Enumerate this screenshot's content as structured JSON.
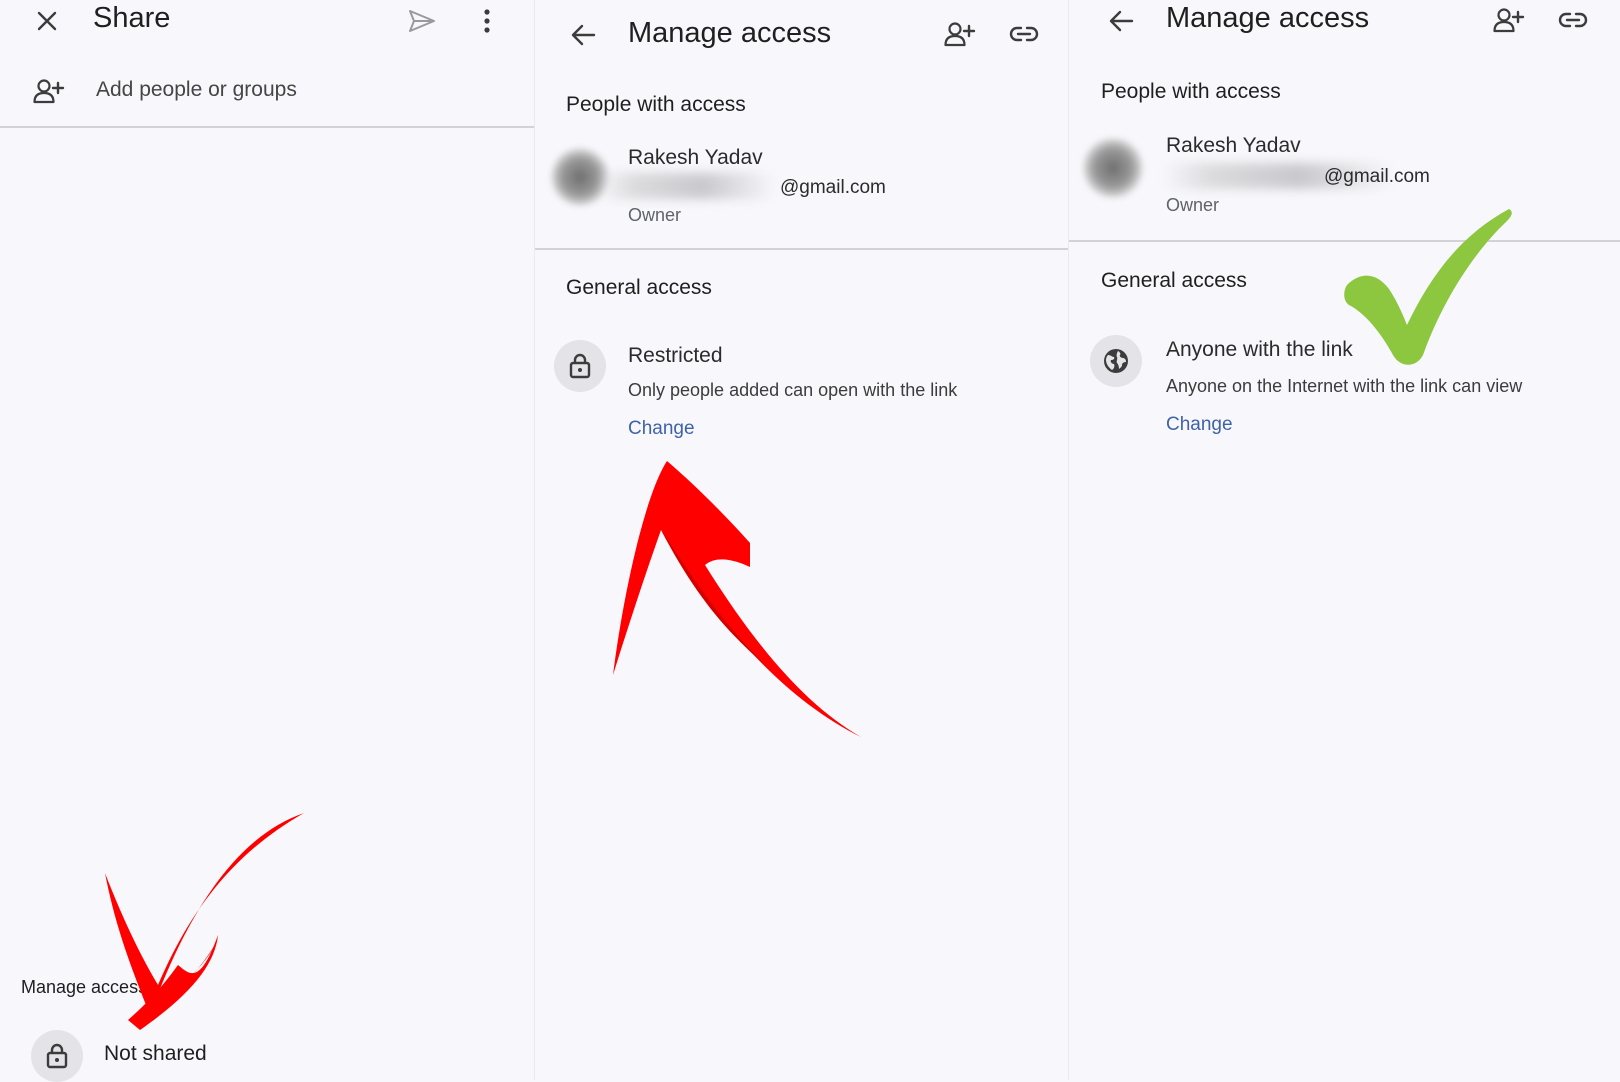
{
  "share_panel": {
    "title": "Share",
    "add_people_label": "Add people or groups",
    "manage_access_label": "Manage access",
    "status_label": "Not shared",
    "icons": {
      "close": "close-icon",
      "send": "send-icon",
      "more": "more-vert-icon",
      "add_person": "person-add-icon",
      "lock": "lock-icon"
    }
  },
  "manage_panel_restricted": {
    "title": "Manage access",
    "people_section": "People with access",
    "person": {
      "name": "Rakesh Yadav",
      "email_visible": "@gmail.com",
      "role": "Owner"
    },
    "general_section": "General access",
    "access": {
      "title": "Restricted",
      "description": "Only people added can open with the link",
      "change_label": "Change"
    },
    "icons": {
      "back": "back-arrow-icon",
      "add_person": "person-add-icon",
      "link": "link-icon",
      "lock": "lock-icon"
    }
  },
  "manage_panel_anyone": {
    "title": "Manage access",
    "people_section": "People with access",
    "person": {
      "name": "Rakesh Yadav",
      "email_visible": "@gmail.com",
      "role": "Owner"
    },
    "general_section": "General access",
    "access": {
      "title": "Anyone with the link",
      "description": "Anyone on the Internet with the link can view",
      "change_label": "Change"
    },
    "icons": {
      "back": "back-arrow-icon",
      "add_person": "person-add-icon",
      "link": "link-icon",
      "globe": "globe-icon"
    }
  },
  "annotations": {
    "arrow_color": "#ff0000",
    "check_color": "#8dc63f",
    "icons": [
      "red-arrow-down-icon",
      "red-arrow-up-icon",
      "green-checkmark-icon"
    ]
  },
  "colors": {
    "background": "#f8f7fb",
    "link": "#3f63a8",
    "divider": "#d3d3d6",
    "icon_circle": "#e4e3e8"
  }
}
